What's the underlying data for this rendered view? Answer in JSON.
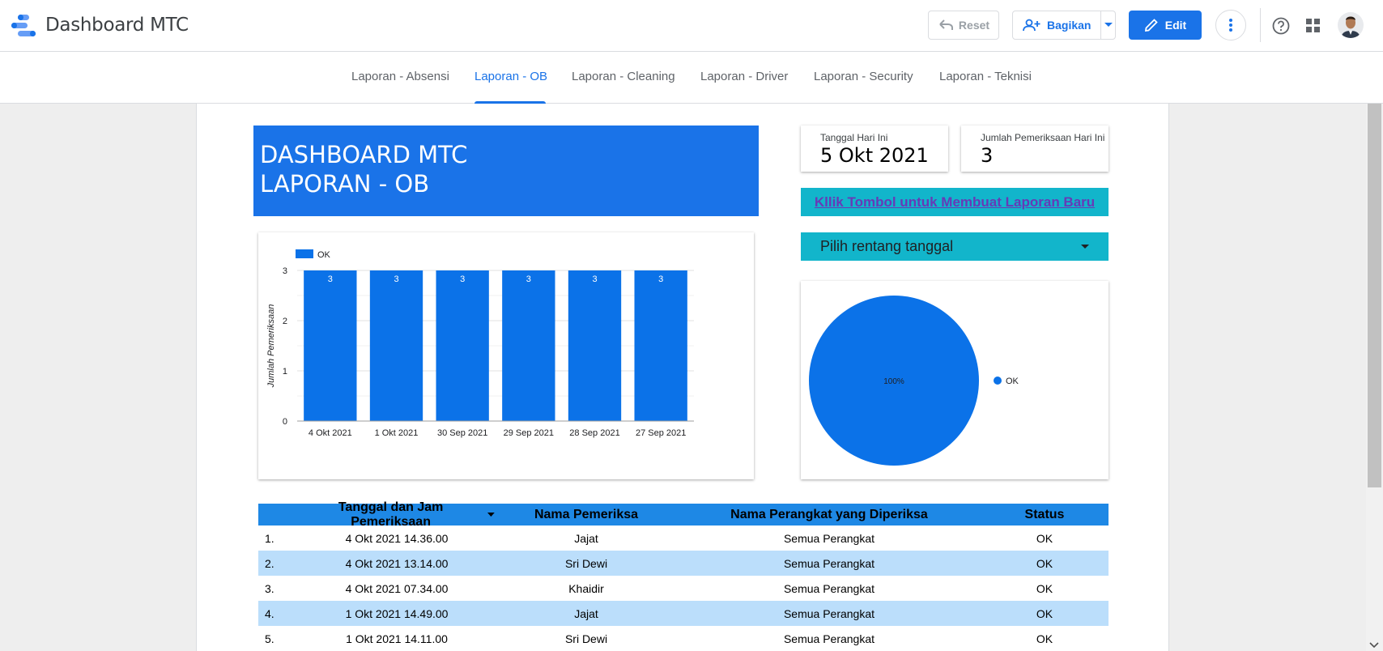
{
  "app": {
    "title": "Dashboard MTC",
    "reset_label": "Reset",
    "share_label": "Bagikan",
    "edit_label": "Edit"
  },
  "tabs": [
    {
      "label": "Laporan - Absensi"
    },
    {
      "label": "Laporan - OB",
      "active": true
    },
    {
      "label": "Laporan - Cleaning"
    },
    {
      "label": "Laporan - Driver"
    },
    {
      "label": "Laporan - Security"
    },
    {
      "label": "Laporan - Teknisi"
    }
  ],
  "banner": {
    "line1": "DASHBOARD MTC",
    "line2": "LAPORAN - OB"
  },
  "scorecards": [
    {
      "label": "Tanggal Hari Ini",
      "value": "5 Okt 2021"
    },
    {
      "label": "Jumlah Pemeriksaan Hari Ini",
      "value": "3"
    }
  ],
  "new_report_link": "Kllik Tombol untuk Membuat Laporan Baru",
  "date_range": {
    "label": "Pilih rentang tanggal"
  },
  "colors": {
    "primary": "#1a73e8",
    "series": "#0b72e8",
    "teal": "#12b5cb",
    "link": "#673ab7",
    "table_header": "#1e88e5",
    "row_alt": "#bbdefb"
  },
  "chart_data": [
    {
      "type": "bar",
      "categories": [
        "4 Okt 2021",
        "1 Okt 2021",
        "30 Sep 2021",
        "29 Sep 2021",
        "28 Sep 2021",
        "27 Sep 2021"
      ],
      "series": [
        {
          "name": "OK",
          "values": [
            3,
            3,
            3,
            3,
            3,
            3
          ]
        }
      ],
      "ylabel": "Jumlah Pemeriksaan",
      "yticks": [
        0,
        1,
        2,
        3
      ],
      "ylim": [
        0,
        3
      ],
      "legend": "top-left",
      "data_labels": true
    },
    {
      "type": "pie",
      "slices": [
        {
          "name": "OK",
          "value": 100,
          "label": "100%"
        }
      ],
      "legend": "right"
    }
  ],
  "table": {
    "headers": [
      "Tanggal dan Jam Pemeriksaan",
      "Nama Pemeriksa",
      "Nama Perangkat yang Diperiksa",
      "Status"
    ],
    "rows": [
      {
        "no": "1.",
        "datetime": "4 Okt 2021 14.36.00",
        "inspector": "Jajat",
        "device": "Semua Perangkat",
        "status": "OK"
      },
      {
        "no": "2.",
        "datetime": "4 Okt 2021 13.14.00",
        "inspector": "Sri Dewi",
        "device": "Semua Perangkat",
        "status": "OK"
      },
      {
        "no": "3.",
        "datetime": "4 Okt 2021 07.34.00",
        "inspector": "Khaidir",
        "device": "Semua Perangkat",
        "status": "OK"
      },
      {
        "no": "4.",
        "datetime": "1 Okt 2021 14.49.00",
        "inspector": "Jajat",
        "device": "Semua Perangkat",
        "status": "OK"
      },
      {
        "no": "5.",
        "datetime": "1 Okt 2021 14.11.00",
        "inspector": "Sri Dewi",
        "device": "Semua Perangkat",
        "status": "OK"
      }
    ]
  }
}
